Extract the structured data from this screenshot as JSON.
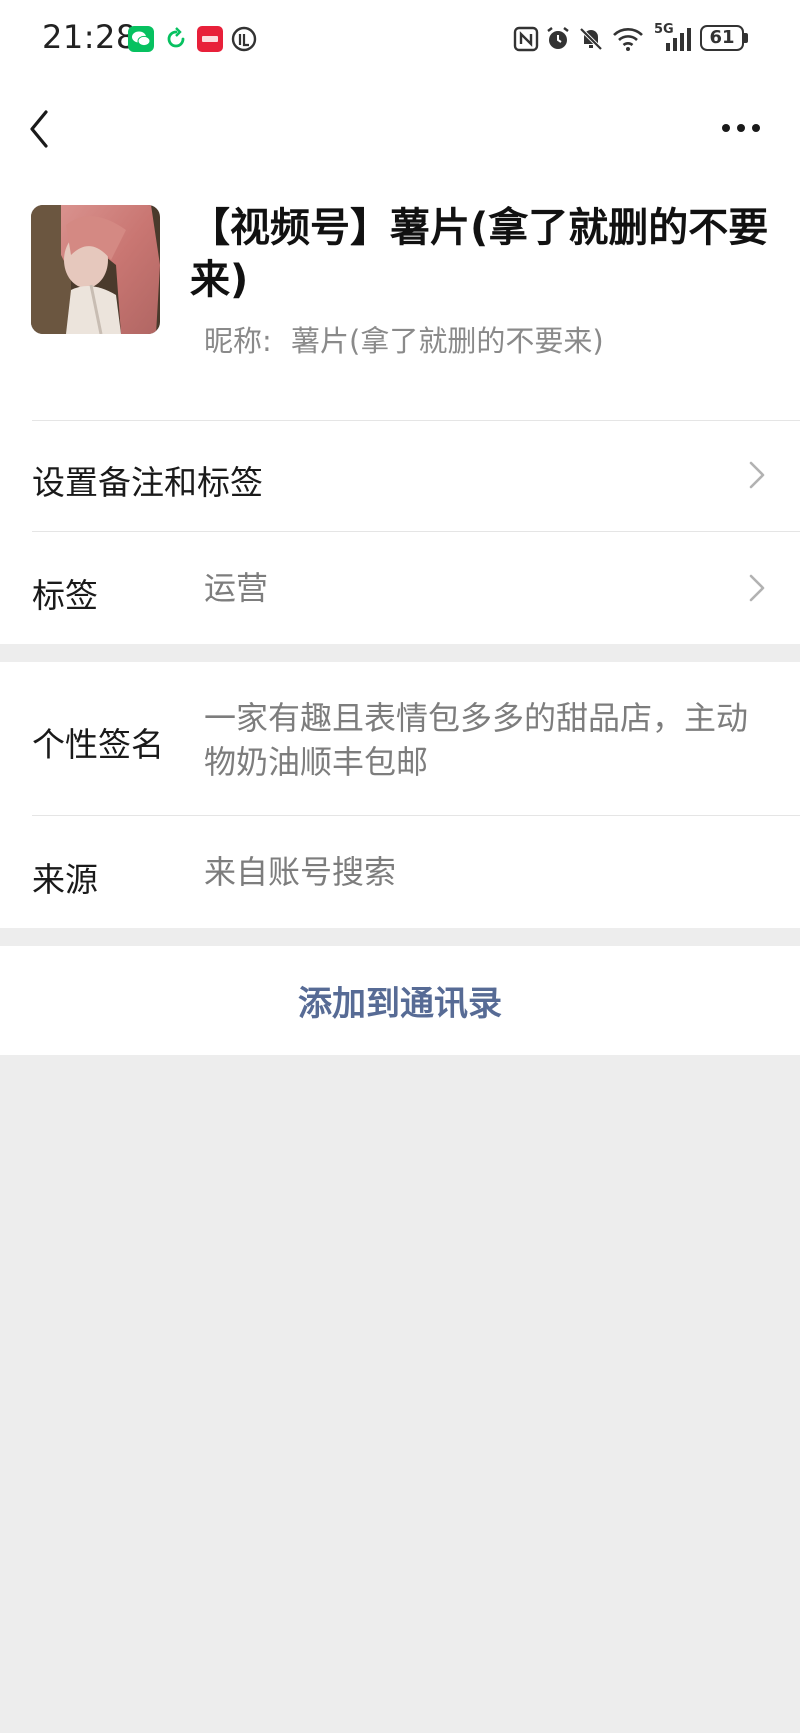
{
  "status_bar": {
    "time": "21:28",
    "battery": "61",
    "network": "5G",
    "left_icons": [
      "wechat-icon",
      "sync-icon",
      "app-badge-icon",
      "vpn-icon"
    ],
    "right_icons": [
      "nfc-icon",
      "alarm-icon",
      "mute-icon",
      "wifi-icon",
      "signal-icon",
      "battery-icon"
    ]
  },
  "nav": {
    "back_icon": "chevron-left-icon",
    "more_icon": "more-icon"
  },
  "profile": {
    "title": "【视频号】薯片(拿了就删的不要来)",
    "nickname_label": "昵称:",
    "nickname": "薯片(拿了就删的不要来)"
  },
  "rows": {
    "remark": {
      "label": "设置备注和标签"
    },
    "tags": {
      "label": "标签",
      "value": "运营"
    },
    "signature": {
      "label": "个性签名",
      "value": "一家有趣且表情包多多的甜品店，主动物奶油顺丰包邮"
    },
    "source": {
      "label": "来源",
      "value": "来自账号搜索"
    }
  },
  "actions": {
    "add_contact": "添加到通讯录"
  },
  "colors": {
    "page_background": "#ededed",
    "card_background": "#ffffff",
    "link_blue": "#576b95",
    "secondary_text": "#7d7d7d",
    "wechat_green": "#07c160"
  }
}
